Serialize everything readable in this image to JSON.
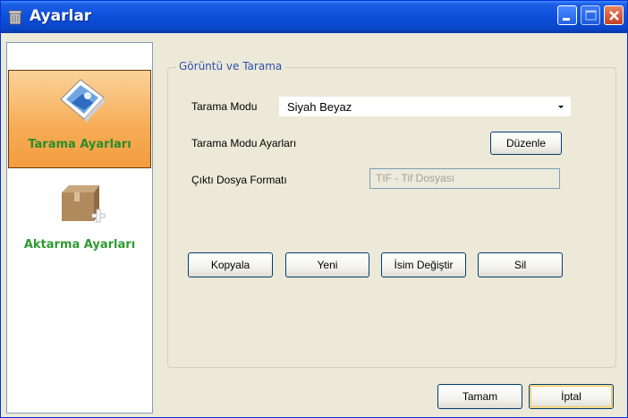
{
  "window": {
    "title": "Ayarlar"
  },
  "sidebar": {
    "items": [
      {
        "label": "Tarama Ayarları",
        "active": true,
        "icon": "scan-settings-icon"
      },
      {
        "label": "Aktarma Ayarları",
        "active": false,
        "icon": "transfer-box-icon"
      }
    ]
  },
  "group": {
    "legend": "Görüntü ve Tarama",
    "scan_mode_label": "Tarama Modu",
    "scan_mode_value": "Siyah Beyaz",
    "scan_mode_settings_label": "Tarama Modu Ayarları",
    "edit_button": "Düzenle",
    "output_format_label": "Çıktı Dosya Formatı",
    "output_format_value": "TIF - Tif Dosyası"
  },
  "actions": {
    "copy": "Kopyala",
    "new": "Yeni",
    "rename": "İsim Değiştir",
    "delete": "Sil"
  },
  "footer": {
    "ok": "Tamam",
    "cancel": "İptal"
  }
}
